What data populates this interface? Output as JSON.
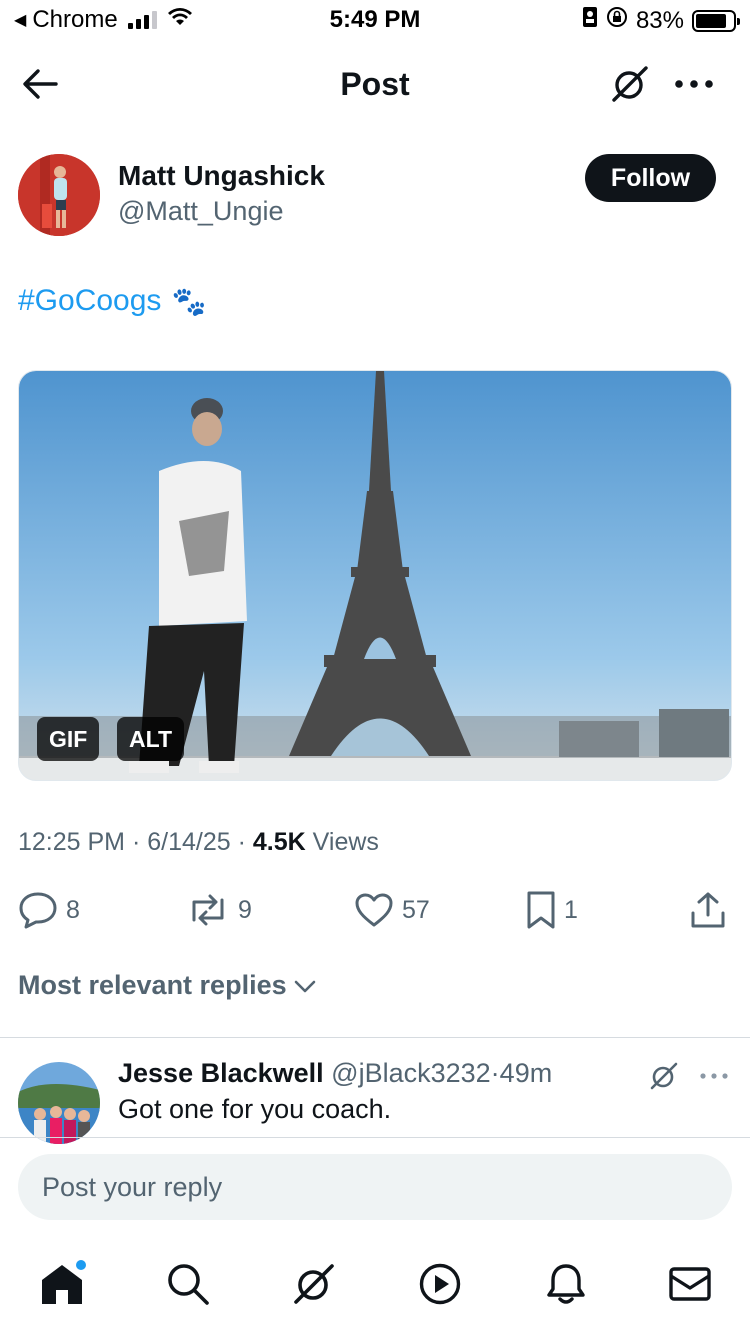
{
  "status_bar": {
    "back_app": "Chrome",
    "time": "5:49 PM",
    "battery": "83%",
    "battery_level": 0.83,
    "back_icon": "back-arrow-small-icon",
    "signal_icon": "cellular-signal-icon",
    "wifi_icon": "wifi-icon",
    "lock_icon": "portrait-lock-icon",
    "id_icon": "id-badge-icon"
  },
  "header": {
    "title": "Post",
    "back_icon": "back-arrow-icon",
    "grok_icon": "grok-icon",
    "more_icon": "more-dots-icon"
  },
  "author": {
    "name": "Matt Ungashick",
    "handle": "@Matt_Ungie",
    "follow_label": "Follow"
  },
  "post": {
    "text": "#GoCoogs",
    "emoji": "🐾",
    "media_badges": {
      "gif": "GIF",
      "alt": "ALT"
    },
    "time": "12:25 PM",
    "sep1": "·",
    "date": "6/14/25",
    "sep2": "·",
    "views_count": "4.5K",
    "views_label": "Views"
  },
  "actions": {
    "replies": "8",
    "reposts": "9",
    "likes": "57",
    "bookmarks": "1"
  },
  "sort": {
    "label": "Most relevant replies"
  },
  "reply": {
    "name": "Jesse Blackwell",
    "handle": "@jBlack3232",
    "sep": "·",
    "age": "49m",
    "text": "Got one for you coach."
  },
  "composer": {
    "placeholder": "Post your reply"
  },
  "colors": {
    "accent": "#1d9bf0",
    "text": "#0f1419",
    "muted": "#536471",
    "input_bg": "#eff3f4"
  },
  "nav": [
    "home-icon",
    "search-icon",
    "grok-icon",
    "video-icon",
    "bell-icon",
    "mail-icon"
  ]
}
